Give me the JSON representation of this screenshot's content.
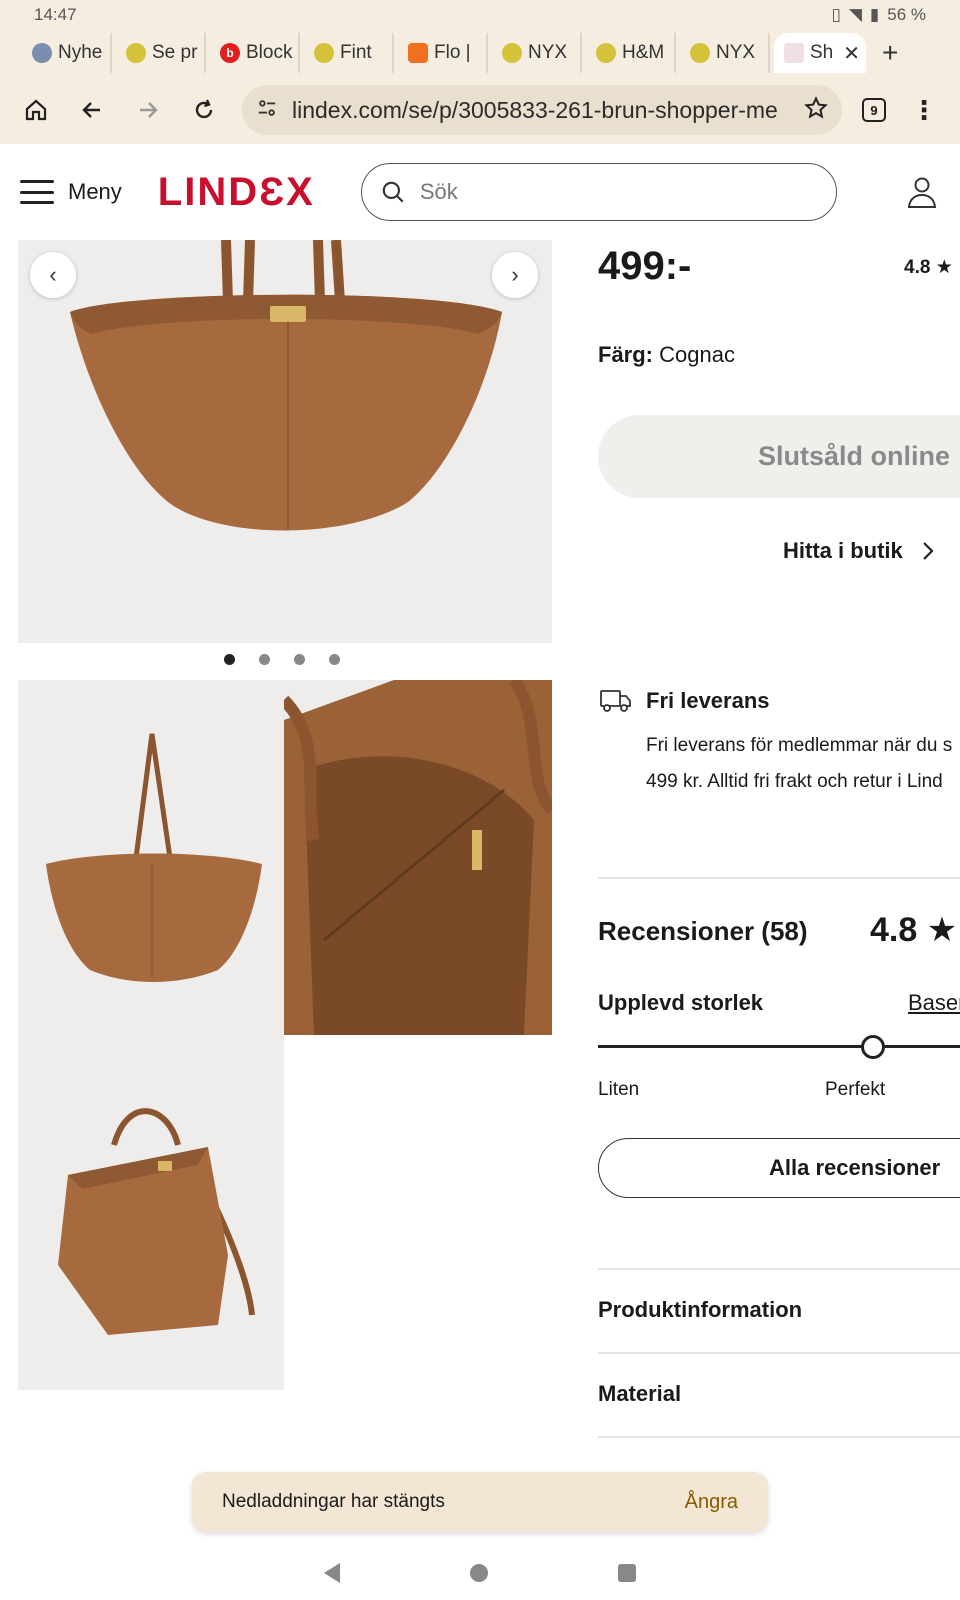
{
  "status": {
    "time": "14:47",
    "battery": "56 %"
  },
  "tabs": [
    {
      "label": "Nyhe",
      "fav_color": "#7a8fb0"
    },
    {
      "label": "Se pr",
      "fav_color": "#d4c23a"
    },
    {
      "label": "Block",
      "fav_color": "#e02020"
    },
    {
      "label": "Fint",
      "fav_color": "#d4c23a"
    },
    {
      "label": "Flo |",
      "fav_color": "#f07020"
    },
    {
      "label": "NYX",
      "fav_color": "#d4c23a"
    },
    {
      "label": "H&M",
      "fav_color": "#d4c23a"
    },
    {
      "label": "NYX",
      "fav_color": "#d4c23a"
    },
    {
      "label": "Sh",
      "fav_color": "#c8102e"
    }
  ],
  "toolbar": {
    "url": "lindex.com/se/p/3005833-261-brun-shopper-me",
    "tab_count": "9"
  },
  "header": {
    "menu_label": "Meny",
    "logo": "LINDƐX",
    "search_placeholder": "Sök"
  },
  "product": {
    "price": "499:-",
    "rating_top": "4.8",
    "color_label": "Färg:",
    "color_value": "Cognac",
    "soldout_label": "Slutsåld online",
    "find_store_label": "Hitta i butik",
    "brand_color": "#c8102e"
  },
  "delivery": {
    "title": "Fri leverans",
    "line1": "Fri leverans för medlemmar när du s",
    "line2": "499 kr. Alltid fri frakt och retur i Lind"
  },
  "reviews": {
    "title": "Recensioner (58)",
    "score": "4.8",
    "fit_title": "Upplevd storlek",
    "fit_link": "Baser",
    "fit_small": "Liten",
    "fit_perfect": "Perfekt",
    "fit_level": 0.75,
    "all_reviews_label": "Alla recensioner"
  },
  "accordion": [
    {
      "label": "Produktinformation"
    },
    {
      "label": "Material"
    }
  ],
  "gallery": {
    "dots": 4,
    "active_dot": 0
  },
  "toast": {
    "message": "Nedladdningar har stängts",
    "undo_label": "Ångra"
  }
}
